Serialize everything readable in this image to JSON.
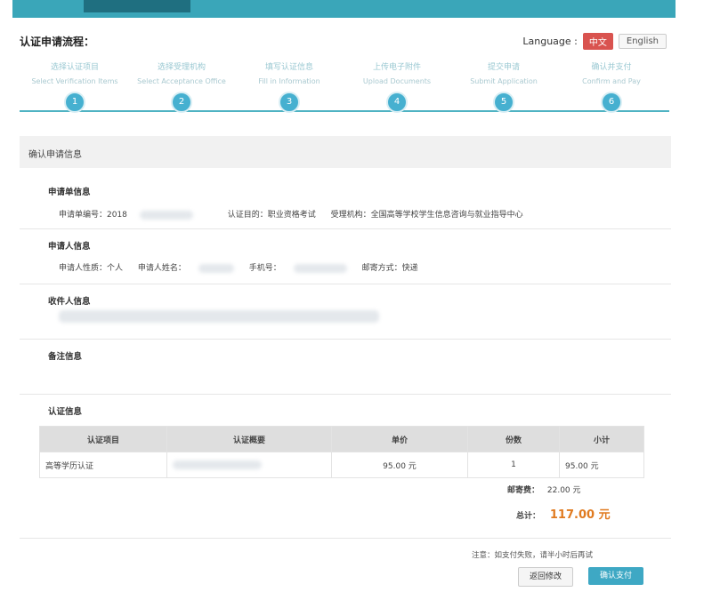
{
  "header": {
    "title": "认证申请流程："
  },
  "language": {
    "label": "Language :",
    "zh": "中文",
    "en": "English"
  },
  "steps": [
    {
      "cn": "选择认证项目",
      "en": "Select Verification Items",
      "num": "1"
    },
    {
      "cn": "选择受理机构",
      "en": "Select Acceptance Office",
      "num": "2"
    },
    {
      "cn": "填写认证信息",
      "en": "Fill in Information",
      "num": "3"
    },
    {
      "cn": "上传电子附件",
      "en": "Upload Documents",
      "num": "4"
    },
    {
      "cn": "提交申请",
      "en": "Submit Application",
      "num": "5"
    },
    {
      "cn": "确认并支付",
      "en": "Confirm and Pay",
      "num": "6"
    }
  ],
  "confirm": {
    "title": "确认申请信息"
  },
  "application": {
    "title": "申请单信息",
    "number_label": "申请单编号：2018",
    "purpose": "认证目的：职业资格考试",
    "office": "受理机构：全国高等学校学生信息咨询与就业指导中心"
  },
  "applicant": {
    "title": "申请人信息",
    "type": "申请人性质：个人",
    "name_label": "申请人姓名：",
    "phone_label": "手机号：",
    "mail": "邮寄方式：快递"
  },
  "recipient": {
    "title": "收件人信息"
  },
  "remark": {
    "title": "备注信息"
  },
  "cert": {
    "title": "认证信息",
    "headers": [
      "认证项目",
      "认证概要",
      "单价",
      "份数",
      "小计"
    ],
    "rows": [
      {
        "item": "高等学历认证",
        "summary": "",
        "price": "95.00 元",
        "qty": "1",
        "subtotal": "95.00 元"
      }
    ],
    "postage_label": "邮寄费：",
    "postage_value": "22.00 元",
    "total_label": "总计：",
    "total_value": "117.00 元"
  },
  "footer": {
    "note": "注意：如支付失败，请半小时后再试",
    "back": "返回修改",
    "pay": "确认支付"
  }
}
